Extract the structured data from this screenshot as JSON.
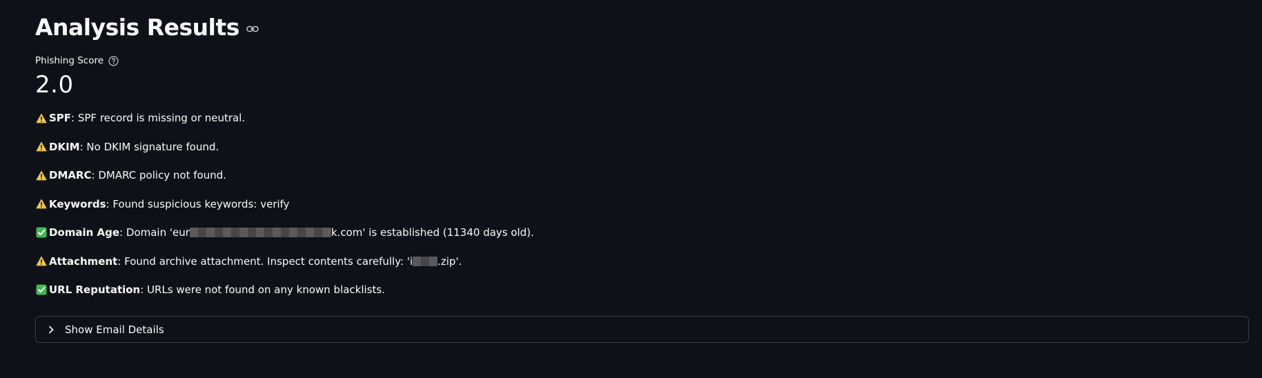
{
  "header": {
    "title": "Analysis Results",
    "link_icon": "link-icon"
  },
  "metric": {
    "label": "Phishing Score",
    "help_icon": "question-circle-icon",
    "value": "2.0"
  },
  "checks": [
    {
      "status": "warning",
      "icon": "warning-icon",
      "name": "SPF",
      "text": ": SPF record is missing or neutral."
    },
    {
      "status": "warning",
      "icon": "warning-icon",
      "name": "DKIM",
      "text": ": No DKIM signature found."
    },
    {
      "status": "warning",
      "icon": "warning-icon",
      "name": "DMARC",
      "text": ": DMARC policy not found."
    },
    {
      "status": "warning",
      "icon": "warning-icon",
      "name": "Keywords",
      "text": ": Found suspicious keywords: verify"
    },
    {
      "status": "ok",
      "icon": "check-icon",
      "name": "Domain Age",
      "text_before": ": Domain 'eur",
      "text_after": "k.com' is established (11340 days old)."
    },
    {
      "status": "warning",
      "icon": "warning-icon",
      "name": "Attachment",
      "text_before": ": Found archive attachment. Inspect contents carefully: 'i",
      "text_after": ".zip'."
    },
    {
      "status": "ok",
      "icon": "check-icon",
      "name": "URL Reputation",
      "text": ": URLs were not found on any known blacklists."
    }
  ],
  "expander": {
    "label": "Show Email Details",
    "icon": "chevron-right-icon"
  },
  "colors": {
    "background": "#0e1117",
    "text": "#fafafa",
    "warning": "#f2c94c",
    "ok": "#3fb950",
    "border": "#3a3d45"
  }
}
